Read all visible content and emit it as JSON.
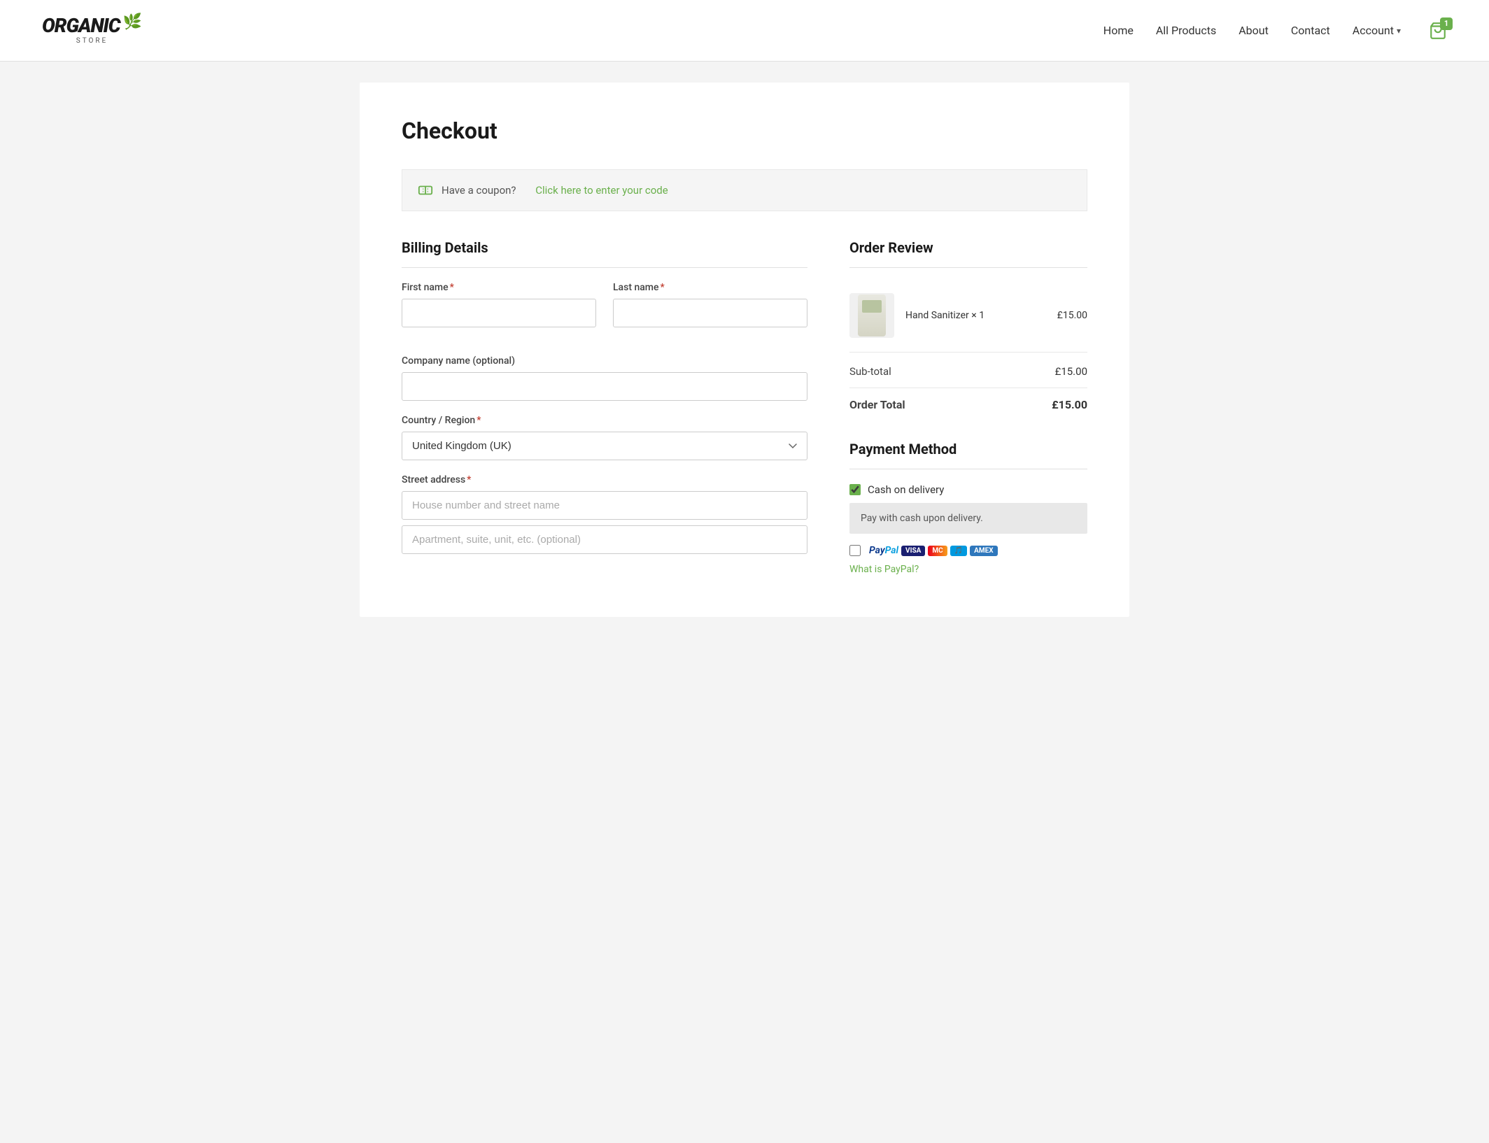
{
  "header": {
    "logo": {
      "brand": "ORGANIC",
      "subtitle": "STORE",
      "leaf": "🌿"
    },
    "nav": {
      "home": "Home",
      "all_products": "All Products",
      "about": "About",
      "contact": "Contact",
      "account": "Account",
      "cart_count": "1"
    }
  },
  "page": {
    "title": "Checkout"
  },
  "coupon": {
    "text": "Have a coupon?",
    "link": "Click here to enter your code"
  },
  "billing": {
    "section_title": "Billing Details",
    "first_name_label": "First name",
    "last_name_label": "Last name",
    "company_label": "Company name (optional)",
    "country_label": "Country / Region",
    "country_value": "United Kingdom (UK)",
    "street_label": "Street address",
    "street_placeholder": "House number and street name",
    "apartment_placeholder": "Apartment, suite, unit, etc. (optional)"
  },
  "order_review": {
    "section_title": "Order Review",
    "product_name": "Hand Sanitizer",
    "product_quantity": "× 1",
    "product_price": "£15.00",
    "subtotal_label": "Sub-total",
    "subtotal_value": "£15.00",
    "total_label": "Order Total",
    "total_value": "£15.00"
  },
  "payment": {
    "section_title": "Payment Method",
    "cash_on_delivery_label": "Cash on delivery",
    "cash_description": "Pay with cash upon delivery.",
    "paypal_label": "PayPal",
    "what_is_paypal": "What is PayPal?"
  }
}
